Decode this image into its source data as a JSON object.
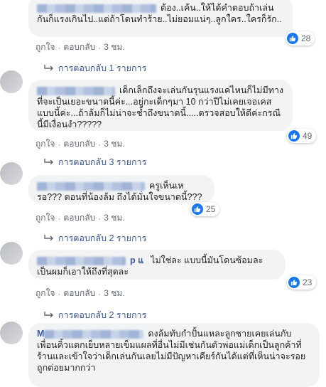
{
  "labels": {
    "like": "ถูกใจ",
    "reply": "ตอบกลับ",
    "dot": "·"
  },
  "comments": [
    {
      "text": "ต้อง..เค้น..ให้ได้คำตอบถ้าเล่นกันก็แรงเกินไป..แต่ถ้าโดนทำร้าย..ไม่ยอมแน่ๆ..ลูกใคร..ใครก็รัก..",
      "reactions": "28",
      "time": "3 ชม.",
      "replies": "การตอบกลับ 1 รายการ"
    },
    {
      "text": "เด็กเล็กถึงจะเล่นกันรุนแรงแค่ไหนก็ไม่มีทางที่จะเป็นเยอะขนาดนี้ค่ะ...อยู่กะเด็กๆมา 10 กว่าปีไม่เคยเจอเคสแบบนี้ค่ะ...ถ้าล้มก็ไม่น่าจะช้ำถึงขนาดนี้.....ตรวจสอบให้ดีค่ะกรณีนี้มีเงื่อนงำ?????",
      "reactions": "49",
      "time": "3 ชม.",
      "replies": "การตอบกลับ 3 รายการ"
    },
    {
      "text": "ครูเห็นเหรอ??? ตอนที่น้องล้ม ถึงได้มั่นใจขนาดนี้???",
      "reactions": "25",
      "time": "3 ชม.",
      "replies": "การตอบกลับ 2 รายการ"
    },
    {
      "name_suffix": "p แ",
      "text": "ไม่ใช่ละ แบบนี้มันโดนซ้อมละ เป็นผมก็เอาให้ถึงที่สุดละ",
      "reactions": "23",
      "time": "3 ชม.",
      "replies": "การตอบกลับ 2 รายการ"
    },
    {
      "name_prefix": "M",
      "text": "ดงล้มทับกำปั้นแหละลูกชายเคยเล่นกับเพื่อนคิ้วแตกเย็บหลายเข็มแผลที่อื่นไม่มีเช่นกันตัวพ่อแม่เด็กเป็นลูกค้าที่ร้านและเข้าใจว่าเด็กเล่นกันเลยไม่มีปัญหาเคียร์กันได้แต่ที่เห็นน่าจะรอยถูกต่อยมากกว่า"
    }
  ]
}
